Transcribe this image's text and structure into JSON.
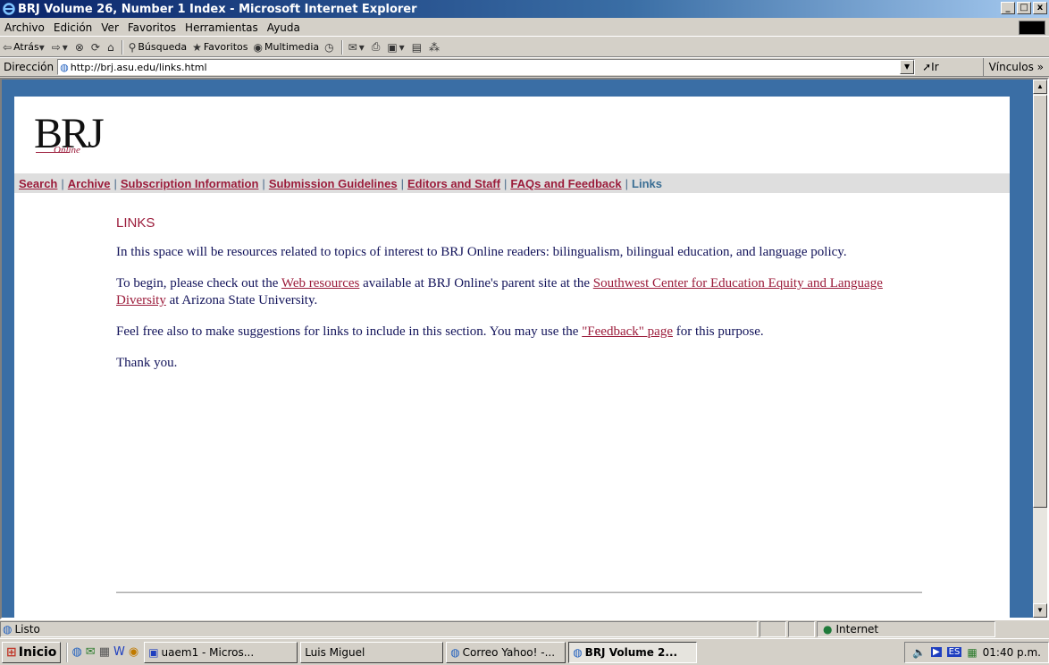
{
  "window": {
    "title": "BRJ Volume 26, Number 1 Index - Microsoft Internet Explorer",
    "controls": [
      "_",
      "□",
      "x"
    ]
  },
  "menu": [
    "Archivo",
    "Edición",
    "Ver",
    "Favoritos",
    "Herramientas",
    "Ayuda"
  ],
  "toolbar": {
    "back": "Atrás",
    "search": "Búsqueda",
    "favorites": "Favoritos",
    "multimedia": "Multimedia"
  },
  "address": {
    "label": "Dirección",
    "url": "http://brj.asu.edu/links.html",
    "go": "Ir",
    "links": "Vínculos »"
  },
  "page": {
    "logo": "BRJ",
    "logo_sub": "Online",
    "nav": {
      "search": "Search",
      "archive": "Archive",
      "subscription": "Subscription Information",
      "submission": "Submission Guidelines",
      "editors": "Editors and Staff",
      "faqs": "FAQs and Feedback",
      "current": "Links",
      "separator": "|"
    },
    "heading": "LINKS",
    "p1": "In this space will be resources related to topics of interest to BRJ Online readers: bilingualism, bilingual education, and language policy.",
    "p2_before": "To begin, please check out the ",
    "p2_link1": "Web resources",
    "p2_middle": " available at BRJ Online's parent site at the ",
    "p2_link2": "Southwest Center for Education Equity and Language Diversity",
    "p2_after": " at Arizona State University.",
    "p3_before": "Feel free also to make suggestions for links to include in this section. You may use the ",
    "p3_link": "\"Feedback\" page",
    "p3_after": " for this purpose.",
    "p4": "Thank you."
  },
  "status": {
    "text": "Listo",
    "zone": "Internet"
  },
  "taskbar": {
    "start": "Inicio",
    "tasks": [
      "uaem1 - Micros...",
      "Luis Miguel",
      "Correo Yahoo! -...",
      "BRJ Volume 2..."
    ],
    "language": "ES",
    "clock": "01:40 p.m."
  }
}
